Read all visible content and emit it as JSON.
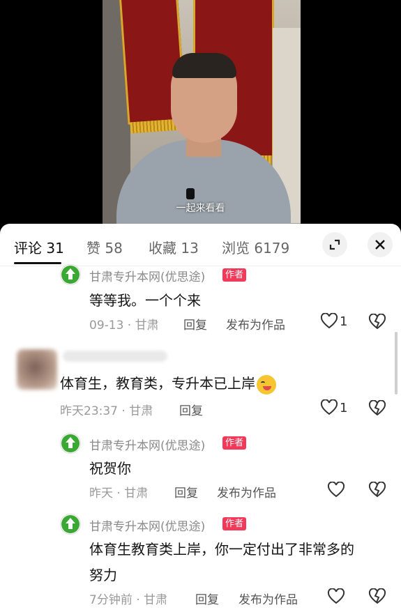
{
  "video": {
    "subtitle": "一起来看看"
  },
  "tabs": [
    {
      "label": "评论 31",
      "active": true
    },
    {
      "label": "赞 58",
      "active": false
    },
    {
      "label": "收藏 13",
      "active": false
    },
    {
      "label": "浏览 6179",
      "active": false
    }
  ],
  "controls": {
    "expand_icon": "expand-icon",
    "close_icon": "close-icon"
  },
  "comments": [
    {
      "author": "甘肃专升本网(优思途)",
      "badge": "作者",
      "text": "等等我。一个个来",
      "date": "09-13 · 甘肃",
      "reply": "回复",
      "publish": "发布为作品",
      "likes": "1"
    },
    {
      "author": "",
      "text": "体育生，教育类，专升本已上岸",
      "date": "昨天23:37 · 甘肃",
      "reply": "回复",
      "likes": "1",
      "emoji": "wink-tongue-emoji"
    },
    {
      "author": "甘肃专升本网(优思途)",
      "badge": "作者",
      "text": "祝贺你",
      "date": "昨天 · 甘肃",
      "reply": "回复",
      "publish": "发布为作品",
      "likes": ""
    },
    {
      "author": "甘肃专升本网(优思途)",
      "badge": "作者",
      "text_line1": "体育生教育类上岸，你一定付出了非常多的",
      "text_line2": "努力",
      "date": "7分钟前 · 甘肃",
      "reply": "回复",
      "publish": "发布为作品",
      "likes": ""
    }
  ],
  "colors": {
    "badge": "#f2395a",
    "author": "#8a8a8a",
    "text": "#151515",
    "meta": "#999999",
    "brand_green": "#3aa832"
  }
}
